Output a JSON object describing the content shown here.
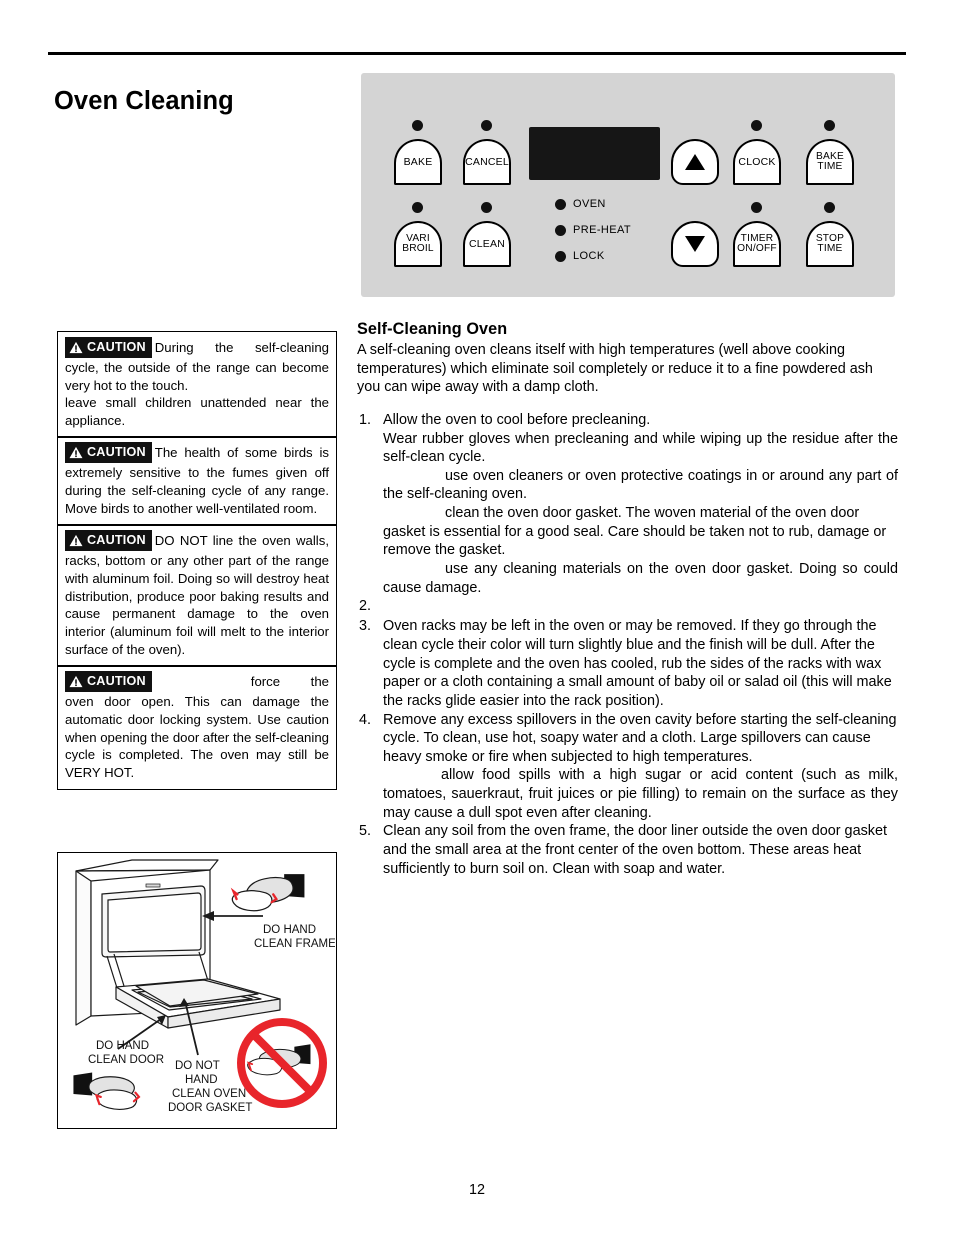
{
  "page": {
    "title": "Oven Cleaning",
    "number": "12"
  },
  "control_panel": {
    "keys": [
      {
        "id": "bake",
        "label": "BAKE",
        "has_led": true
      },
      {
        "id": "cancel",
        "label": "CANCEL",
        "has_led": false
      },
      {
        "id": "vari-broil",
        "label": "VARI\nBROIL",
        "has_led": true
      },
      {
        "id": "clean",
        "label": "CLEAN",
        "has_led": true
      },
      {
        "id": "up-arrow",
        "label": "▲",
        "has_led": false
      },
      {
        "id": "down-arrow",
        "label": "▼",
        "has_led": false
      },
      {
        "id": "clock",
        "label": "CLOCK",
        "has_led": true
      },
      {
        "id": "bake-time",
        "label": "BAKE\nTIME",
        "has_led": true
      },
      {
        "id": "timer-on-off",
        "label": "TIMER\nON/OFF",
        "has_led": true
      },
      {
        "id": "stop-time",
        "label": "STOP\nTIME",
        "has_led": true
      }
    ],
    "key_labels": {
      "bake": "BAKE",
      "cancel": "CANCEL",
      "vari": "VARI",
      "broil": "BROIL",
      "clean": "CLEAN",
      "clock": "CLOCK",
      "bake_time_1": "BAKE",
      "bake_time_2": "TIME",
      "timer_1": "TIMER",
      "timer_2": "ON/OFF",
      "stop_time_1": "STOP",
      "stop_time_2": "TIME"
    },
    "indicators": [
      {
        "id": "oven",
        "label": "OVEN"
      },
      {
        "id": "pre-heat",
        "label": "PRE-HEAT"
      },
      {
        "id": "lock",
        "label": "LOCK"
      }
    ],
    "indicator_labels": {
      "oven": "OVEN",
      "pre_heat": "PRE-HEAT",
      "lock": "LOCK"
    },
    "display_value": "",
    "colors": {
      "panel_background": "#d4d4d4",
      "display_background": "#161616",
      "key_background": "#ffffff",
      "led": "#111111"
    }
  },
  "cautions": {
    "badge_label": "CAUTION",
    "items": [
      {
        "id": "hot-surface",
        "lines": [
          "During the self-cleaning cycle, the outside of the range can become very hot to the touch.",
          "leave small children unattended near the appliance."
        ],
        "line1": "During the self-cleaning cycle, the outside of the range can become very hot to the touch.",
        "line2": "leave small children unattended near the appliance."
      },
      {
        "id": "birds",
        "line1": "The health of some birds is extremely sensitive to the fumes given off during the self-cleaning cycle of any range.  Move birds to another well-ventilated room.",
        "line2": ""
      },
      {
        "id": "aluminum-foil",
        "line1": "DO NOT line the oven walls, racks, bottom or any other  part of the range with aluminum foil. Doing so will destroy heat distribution, produce poor baking results and cause permanent damage to the oven interior (aluminum foil will melt to the interior surface of the oven).",
        "line2": ""
      },
      {
        "id": "door-force",
        "line1": "force the oven door open. This can damage the automatic door locking system. Use caution when opening the door after the self-cleaning cycle is completed. The oven may still be VERY HOT.",
        "line2": ""
      }
    ]
  },
  "illustration": {
    "callouts": {
      "frame_line1": "DO HAND",
      "frame_line2": "CLEAN FRAME",
      "door_line1": "DO HAND",
      "door_line2": "CLEAN DOOR",
      "gasket_line1": "DO  NOT",
      "gasket_line2": "HAND",
      "gasket_line3": "CLEAN OVEN",
      "gasket_line4": "DOOR GASKET"
    },
    "colors": {
      "prohibition": "#e8252b",
      "outline": "#1a1a1a",
      "accent": "#e8252b"
    }
  },
  "main": {
    "heading": "Self-Cleaning Oven",
    "intro": "A self-cleaning oven cleans itself with high temperatures (well above cooking temperatures) which eliminate soil completely or reduce it to a fine powdered ash you can wipe away with a damp cloth.",
    "steps": [
      {
        "number": "1.",
        "paragraphs": [
          {
            "text": "Allow the oven to cool before precleaning.",
            "indent": false,
            "justify": false
          },
          {
            "text": "Wear rubber gloves when precleaning and while wiping up the residue after the self-clean cycle.",
            "indent": false,
            "justify": true
          },
          {
            "text": "use oven cleaners or oven protective coatings in or around any part of the self-cleaning oven.",
            "indent": true,
            "justify": true
          },
          {
            "text": "clean the oven door gasket. The woven material of the oven door gasket is essential for a good seal. Care should be taken not to rub, damage or remove the gasket.",
            "indent": true,
            "justify": false
          },
          {
            "text": "use any cleaning materials on the oven door gasket. Doing so could cause damage.",
            "indent": true,
            "justify": true
          }
        ]
      },
      {
        "number": "2.",
        "paragraphs": []
      },
      {
        "number": "3.",
        "paragraphs": [
          {
            "text": "Oven racks may be left in the oven or may be removed. If they go through the clean cycle their color will turn slightly blue and the finish will be dull. After the cycle is complete and the oven has cooled, rub the sides of the racks with wax paper or a cloth containing a small amount of baby oil or salad oil (this will make the racks glide easier into the rack position).",
            "indent": false,
            "justify": false
          }
        ]
      },
      {
        "number": "4.",
        "paragraphs": [
          {
            "text": "Remove any excess spillovers in the oven cavity before starting the self-cleaning cycle. To clean, use hot, soapy water and a cloth. Large spillovers can cause heavy smoke or fire when subjected to high temperatures.",
            "indent": false,
            "justify": false
          },
          {
            "text": "allow food spills with a high sugar or acid content (such as milk, tomatoes, sauerkraut, fruit juices or pie filling) to remain on the surface as they may cause a dull spot even after cleaning.",
            "indent": true,
            "justify": true
          }
        ]
      },
      {
        "number": "5.",
        "paragraphs": [
          {
            "text": "Clean any soil from the oven frame, the door liner outside the oven door gasket and the small area at the front center of the oven bottom. These areas heat sufficiently to burn soil on. Clean with soap and water.",
            "indent": false,
            "justify": false
          }
        ]
      }
    ],
    "step_text": {
      "s1p1": "Allow the oven to cool before precleaning.",
      "s1p2": "Wear rubber gloves when precleaning and while wiping up the residue after the self-clean cycle.",
      "s1p3": "use oven cleaners or oven protective coatings in or around any part of the self-cleaning oven.",
      "s1p4": "clean the oven door gasket. The woven material of the oven door gasket is essential for a good seal. Care should be taken not to rub, damage or remove the gasket.",
      "s1p5": "use any cleaning materials on the oven door gasket. Doing so could cause damage.",
      "s3p1": "Oven racks may be left in the oven or may be removed. If they go through the clean cycle their color will turn slightly blue and the finish will be dull. After the cycle is complete and the oven has cooled, rub the sides of the racks with wax paper or a cloth containing a small amount of baby oil or salad oil (this will make the racks glide easier into the rack position).",
      "s4p1": "Remove any excess spillovers in the oven cavity before starting the self-cleaning cycle. To clean, use hot, soapy water and a cloth. Large spillovers can cause heavy smoke or fire when subjected to high temperatures.",
      "s4p2": "allow food spills with a high sugar or acid content (such as milk, tomatoes, sauerkraut, fruit juices or pie filling) to remain on the surface as they may cause a dull spot even after cleaning.",
      "s5p1": "Clean any soil from the oven frame, the door liner outside the oven door gasket and the small area at the front center of the oven bottom. These areas heat sufficiently to burn soil on. Clean with soap and water."
    },
    "step_numbers": {
      "n1": "1.",
      "n2": "2.",
      "n3": "3.",
      "n4": "4.",
      "n5": "5."
    }
  }
}
